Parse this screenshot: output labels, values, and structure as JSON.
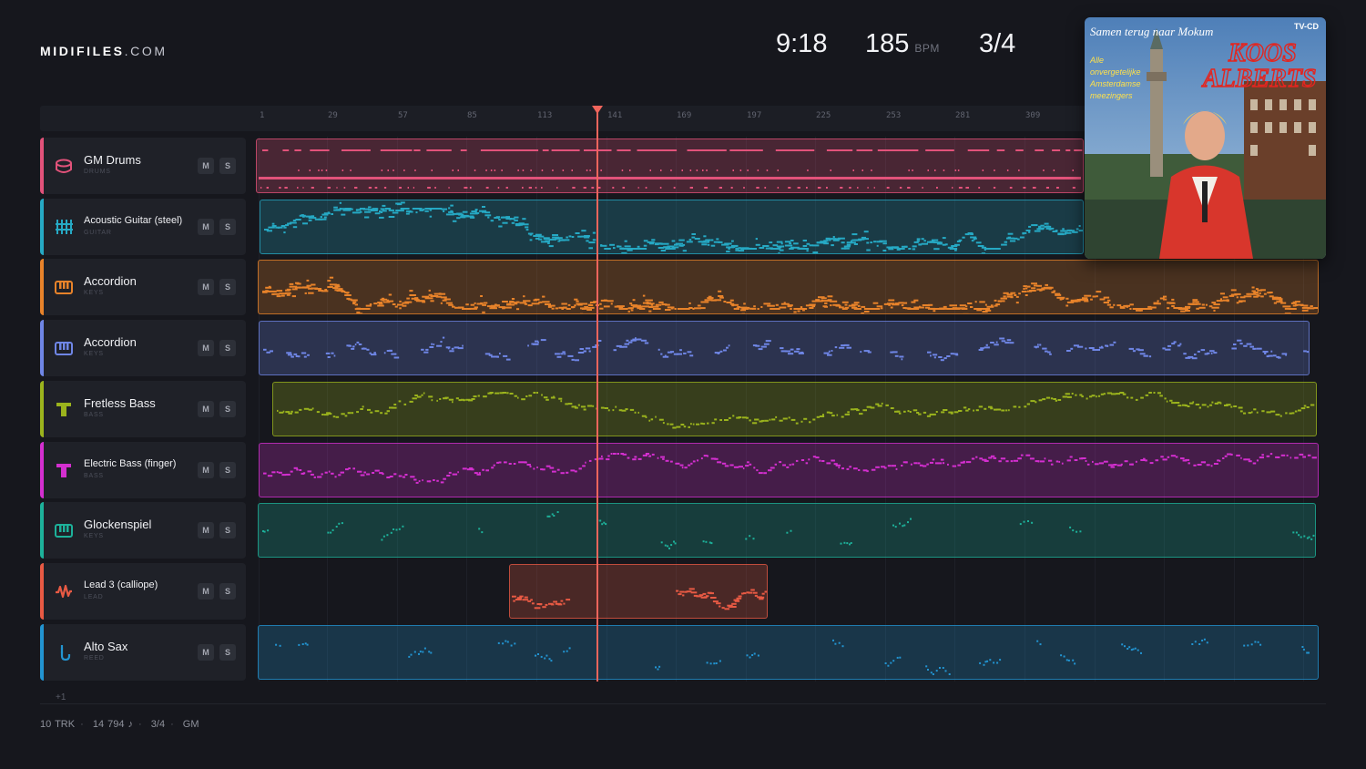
{
  "brand": {
    "name": "MIDIFILES",
    "tld": ".COM"
  },
  "transport": {
    "time": "9:18",
    "bpm": "185",
    "bpm_unit": "BPM",
    "time_signature": "3/4"
  },
  "ruler_ticks": [
    "1",
    "29",
    "57",
    "85",
    "113",
    "141",
    "169",
    "197",
    "225",
    "253",
    "281",
    "309"
  ],
  "tracks": [
    {
      "name": "GM Drums",
      "category": "DRUMS",
      "color": "#e2527a",
      "icon": "drum-icon",
      "style": "drums"
    },
    {
      "name": "Acoustic Guitar (steel)",
      "category": "GUITAR",
      "color": "#26a9c4",
      "icon": "guitar-icon",
      "style": "dense"
    },
    {
      "name": "Accordion",
      "category": "KEYS",
      "color": "#e8832a",
      "icon": "keys-icon",
      "style": "dense"
    },
    {
      "name": "Accordion",
      "category": "KEYS",
      "color": "#6f86e6",
      "icon": "keys-icon",
      "style": "sparse"
    },
    {
      "name": "Fretless Bass",
      "category": "BASS",
      "color": "#9bb31d",
      "icon": "bass-icon",
      "style": "bass"
    },
    {
      "name": "Electric Bass (finger)",
      "category": "BASS",
      "color": "#d42fd0",
      "icon": "bass-icon",
      "style": "bass"
    },
    {
      "name": "Glockenspiel",
      "category": "KEYS",
      "color": "#1db19a",
      "icon": "keys-icon",
      "style": "verysparse"
    },
    {
      "name": "Lead 3 (calliope)",
      "category": "LEAD",
      "color": "#e85a44",
      "icon": "wave-icon",
      "style": "lead"
    },
    {
      "name": "Alto Sax",
      "category": "REED",
      "color": "#2294d1",
      "icon": "sax-icon",
      "style": "verysparse"
    }
  ],
  "buttons": {
    "mute": "M",
    "solo": "S"
  },
  "more_tracks": "+1",
  "album": {
    "title": "Samen terug naar Mokum",
    "badge": "TV-CD",
    "artist_line1": "KOOS",
    "artist_line2": "ALBERTS",
    "tagline": [
      "Alle",
      "onvergetelijke",
      "Amsterdamse",
      "meezingers"
    ]
  },
  "footer": {
    "tracks": "10 TRK",
    "notes": "14 794 ♪",
    "signature": "3/4",
    "standard": "GM"
  }
}
